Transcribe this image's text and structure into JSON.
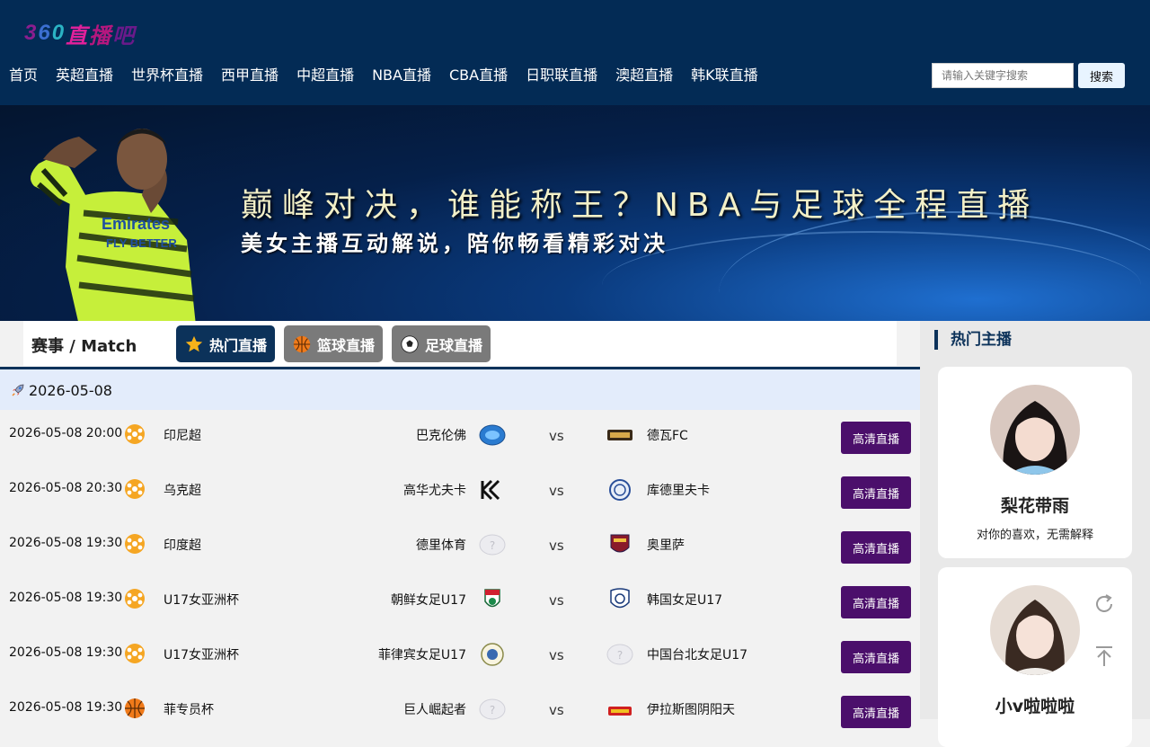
{
  "logo": {
    "chars": [
      "3",
      "6",
      "0",
      "直",
      "播",
      "吧"
    ],
    "colors": [
      "#8b1e8f",
      "#3b6fd1",
      "#2bb3c4",
      "#e0209a",
      "#b4177e",
      "#6a1a8a"
    ]
  },
  "nav": {
    "items": [
      "首页",
      "英超直播",
      "世界杯直播",
      "西甲直播",
      "中超直播",
      "NBA直播",
      "CBA直播",
      "日职联直播",
      "澳超直播",
      "韩K联直播"
    ]
  },
  "search": {
    "placeholder": "请输入关键字搜索",
    "button": "搜索"
  },
  "banner": {
    "title": "巅峰对决，谁能称王？NBA与足球全程直播",
    "subtitle": "美女主播互动解说，陪你畅看精彩对决"
  },
  "tabs": {
    "title": "赛事 / Match",
    "hot": "热门直播",
    "basketball": "篮球直播",
    "football": "足球直播"
  },
  "date_header": "2026-05-08",
  "matches": [
    {
      "time": "2026-05-08 20:00",
      "sport": "football",
      "league": "印尼超",
      "home": "巴克伦佛",
      "away": "德瓦FC",
      "vs": "vs",
      "button": "高清直播"
    },
    {
      "time": "2026-05-08 20:30",
      "sport": "football",
      "league": "乌克超",
      "home": "高华尤夫卡",
      "away": "库德里夫卡",
      "vs": "vs",
      "button": "高清直播"
    },
    {
      "time": "2026-05-08 19:30",
      "sport": "football",
      "league": "印度超",
      "home": "德里体育",
      "away": "奥里萨",
      "vs": "vs",
      "button": "高清直播"
    },
    {
      "time": "2026-05-08 19:30",
      "sport": "football",
      "league": "U17女亚洲杯",
      "home": "朝鲜女足U17",
      "away": "韩国女足U17",
      "vs": "vs",
      "button": "高清直播"
    },
    {
      "time": "2026-05-08 19:30",
      "sport": "football",
      "league": "U17女亚洲杯",
      "home": "菲律宾女足U17",
      "away": "中国台北女足U17",
      "vs": "vs",
      "button": "高清直播"
    },
    {
      "time": "2026-05-08 19:30",
      "sport": "basketball",
      "league": "菲专员杯",
      "home": "巨人崛起者",
      "away": "伊拉斯图阴阳天",
      "vs": "vs",
      "button": "高清直播"
    }
  ],
  "sidebar": {
    "title": "热门主播",
    "anchors": [
      {
        "name": "梨花带雨",
        "desc": "对你的喜欢，无需解释"
      },
      {
        "name": "小v啦啦啦",
        "desc": ""
      }
    ]
  },
  "icons": {
    "refresh": "refresh-icon",
    "back_to_top": "back-to-top-icon"
  },
  "colors": {
    "header_bg": "#032b55",
    "accent": "#0c325a",
    "live_button": "#4b0f6b",
    "date_row": "#e3ecfb"
  }
}
